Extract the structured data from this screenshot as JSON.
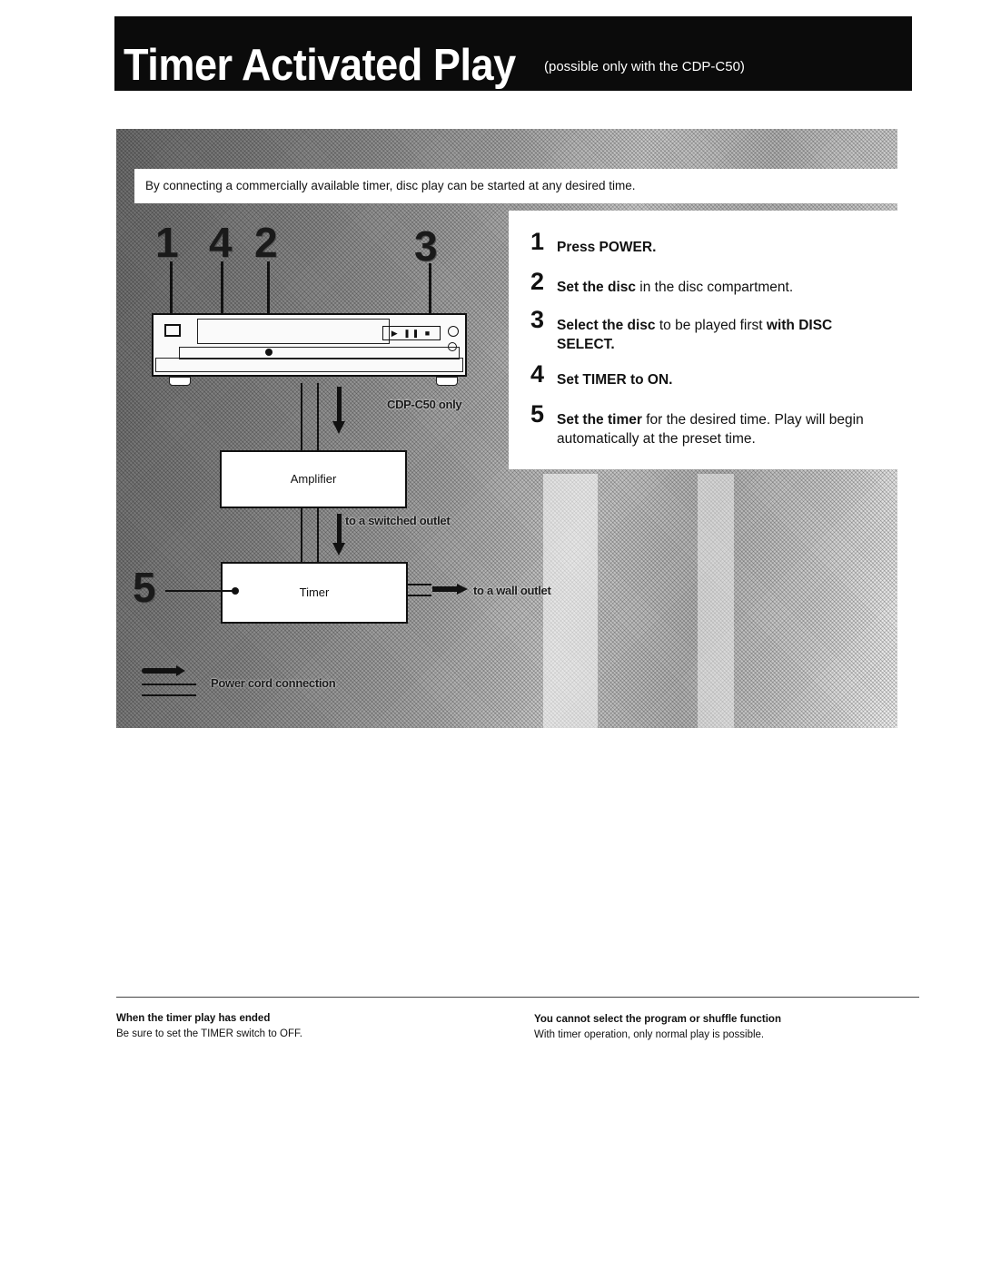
{
  "header": {
    "title": "Timer Activated Play",
    "subtitle": "(possible only with the CDP-C50)"
  },
  "intro": "By connecting a commercially available timer, disc play can be started at any desired time.",
  "steps": [
    {
      "number": "1",
      "bold": "Press POWER.",
      "rest": "",
      "bold2": "",
      "rest2": ""
    },
    {
      "number": "2",
      "bold": "Set the disc",
      "rest": " in the disc compartment.",
      "bold2": "",
      "rest2": ""
    },
    {
      "number": "3",
      "bold": "Select the disc",
      "rest": " to be played first ",
      "bold2": "with DISC SELECT.",
      "rest2": ""
    },
    {
      "number": "4",
      "bold": "Set TIMER to ON.",
      "rest": "",
      "bold2": "",
      "rest2": ""
    },
    {
      "number": "5",
      "bold": "Set the timer",
      "rest": " for the desired time. Play will begin automatically at the preset time.",
      "bold2": "",
      "rest2": ""
    }
  ],
  "diagram": {
    "callouts": [
      "1",
      "4",
      "2",
      "3",
      "5"
    ],
    "player_buttons": "▶ ❚❚ ■",
    "amplifier_label": "Amplifier",
    "timer_label": "Timer",
    "cdp_only_label": "CDP-C50 only",
    "switched_outlet_label": "to a switched outlet",
    "wall_outlet_label": "to a wall outlet",
    "legend_label": "Power cord connection"
  },
  "notes": [
    {
      "title": "When the timer play has ended",
      "body": "Be sure to set the TIMER switch to OFF."
    },
    {
      "title": "You cannot select the program or shuffle function",
      "body": "With timer operation, only normal play is possible."
    }
  ]
}
